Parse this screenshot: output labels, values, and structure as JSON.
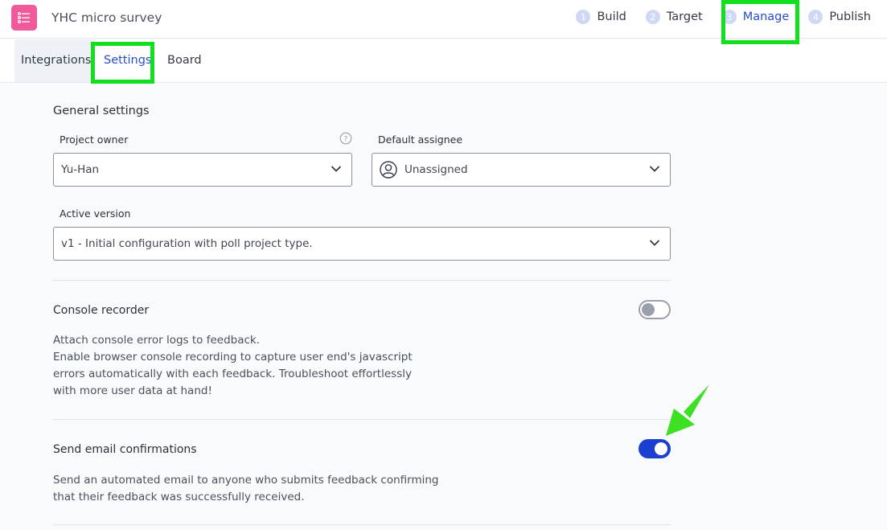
{
  "app": {
    "title": "YHC micro survey",
    "icon": "list-icon",
    "icon_color": "#f05a9a"
  },
  "steps": [
    {
      "num": "1",
      "label": "Build"
    },
    {
      "num": "2",
      "label": "Target"
    },
    {
      "num": "3",
      "label": "Manage",
      "active": true
    },
    {
      "num": "4",
      "label": "Publish"
    }
  ],
  "tabs": [
    {
      "label": "Integrations"
    },
    {
      "label": "Settings",
      "active": true
    },
    {
      "label": "Board"
    }
  ],
  "general": {
    "title": "General settings",
    "owner_label": "Project owner",
    "owner_value": "Yu-Han",
    "assignee_label": "Default assignee",
    "assignee_value": "Unassigned",
    "version_label": "Active version",
    "version_value": "v1 - Initial configuration with poll project type."
  },
  "console_recorder": {
    "title": "Console recorder",
    "enabled": false,
    "description": [
      "Attach console error logs to feedback.",
      "Enable browser console recording to capture user end's javascript",
      "errors automatically with each feedback. Troubleshoot effortlessly",
      "with more user data at hand!"
    ]
  },
  "email_confirmations": {
    "title": "Send email confirmations",
    "enabled": true,
    "description": [
      "Send an automated email to anyone who submits feedback confirming",
      "that their feedback was successfully received."
    ]
  },
  "colors": {
    "accent": "#2a4cc9",
    "toggle_on": "#1b3fd1",
    "highlight": "#12e01e"
  }
}
